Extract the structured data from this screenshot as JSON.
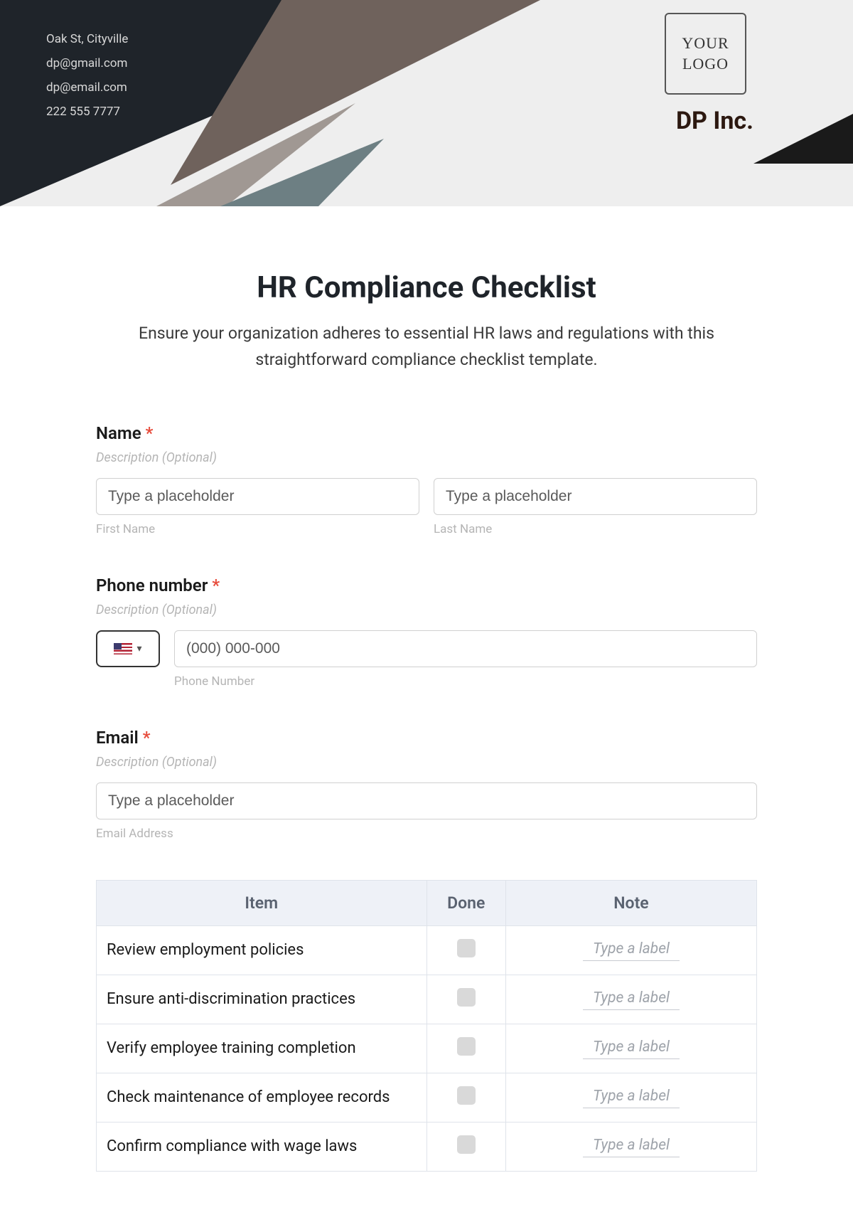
{
  "header": {
    "contact": {
      "address": "Oak St, Cityville",
      "email1": "dp@gmail.com",
      "email2": "dp@email.com",
      "phone": "222 555 7777"
    },
    "logo_text": "YOUR LOGO",
    "company": "DP Inc."
  },
  "form": {
    "title": "HR Compliance Checklist",
    "subtitle": "Ensure your organization adheres to essential HR laws and regulations with this straightforward compliance checklist template.",
    "name": {
      "label": "Name",
      "desc": "Description (Optional)",
      "first_placeholder": "Type a placeholder",
      "last_placeholder": "Type a placeholder",
      "first_sub": "First Name",
      "last_sub": "Last Name"
    },
    "phone": {
      "label": "Phone number",
      "desc": "Description (Optional)",
      "placeholder": "(000) 000-000",
      "sub": "Phone Number"
    },
    "email": {
      "label": "Email",
      "desc": "Description (Optional)",
      "placeholder": "Type a placeholder",
      "sub": "Email Address"
    }
  },
  "table": {
    "headers": {
      "item": "Item",
      "done": "Done",
      "note": "Note"
    },
    "note_placeholder": "Type a label",
    "rows": [
      {
        "item": "Review employment policies"
      },
      {
        "item": "Ensure anti-discrimination practices"
      },
      {
        "item": "Verify employee training completion"
      },
      {
        "item": "Check maintenance of employee records"
      },
      {
        "item": "Confirm compliance with wage laws"
      }
    ]
  }
}
